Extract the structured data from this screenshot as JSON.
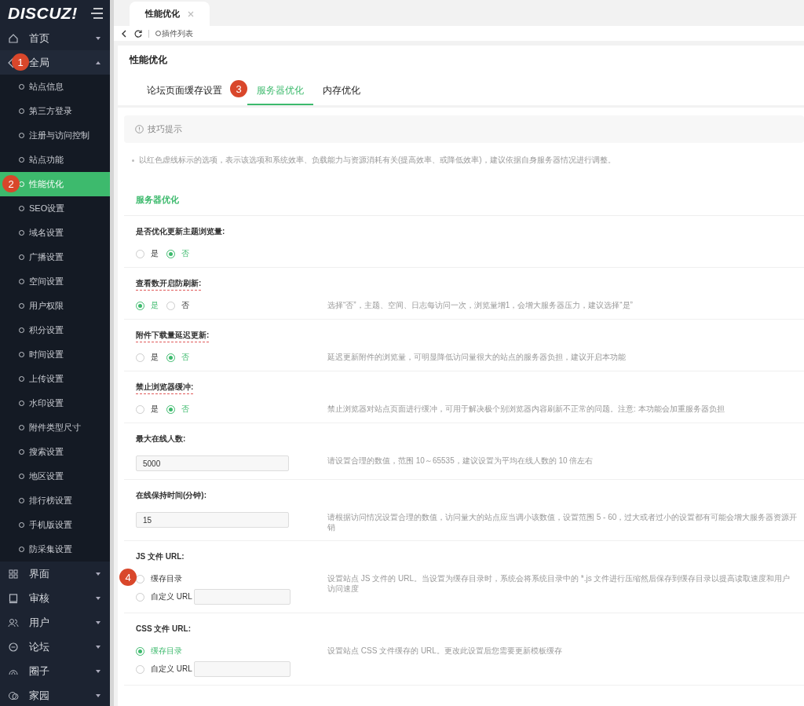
{
  "sidebar": {
    "logo": "DISCUZ!",
    "items": [
      {
        "label": "首页",
        "expanded": false
      },
      {
        "label": "全局",
        "expanded": true,
        "annotation": "1",
        "children": [
          {
            "label": "站点信息",
            "selected": false
          },
          {
            "label": "第三方登录",
            "selected": false
          },
          {
            "label": "注册与访问控制",
            "selected": false
          },
          {
            "label": "站点功能",
            "selected": false
          },
          {
            "label": "性能优化",
            "selected": true,
            "annotation": "2"
          },
          {
            "label": "SEO设置",
            "selected": false
          },
          {
            "label": "域名设置",
            "selected": false
          },
          {
            "label": "广播设置",
            "selected": false
          },
          {
            "label": "空间设置",
            "selected": false
          },
          {
            "label": "用户权限",
            "selected": false
          },
          {
            "label": "积分设置",
            "selected": false
          },
          {
            "label": "时间设置",
            "selected": false
          },
          {
            "label": "上传设置",
            "selected": false
          },
          {
            "label": "水印设置",
            "selected": false
          },
          {
            "label": "附件类型尺寸",
            "selected": false
          },
          {
            "label": "搜索设置",
            "selected": false
          },
          {
            "label": "地区设置",
            "selected": false
          },
          {
            "label": "排行榜设置",
            "selected": false
          },
          {
            "label": "手机版设置",
            "selected": false
          },
          {
            "label": "防采集设置",
            "selected": false
          }
        ]
      },
      {
        "label": "界面",
        "expanded": false
      },
      {
        "label": "审核",
        "expanded": false
      },
      {
        "label": "用户",
        "expanded": false
      },
      {
        "label": "论坛",
        "expanded": false
      },
      {
        "label": "圈子",
        "expanded": false
      },
      {
        "label": "家园",
        "expanded": false
      }
    ]
  },
  "page_tabs": [
    {
      "label": "性能优化",
      "selected": true
    }
  ],
  "toolbar": {
    "link": "插件列表"
  },
  "page": {
    "title": "性能优化",
    "tabs": [
      {
        "label": "论坛页面缓存设置",
        "selected": false
      },
      {
        "label": "服务器优化",
        "selected": true,
        "annotation": "3"
      },
      {
        "label": "内存优化",
        "selected": false
      }
    ]
  },
  "tip": {
    "title": "技巧提示",
    "notes": [
      "以红色虚线标示的选项，表示该选项和系统效率、负载能力与资源消耗有关(提高效率、或降低效率)，建议依据自身服务器情况进行调整。"
    ]
  },
  "section": {
    "title": "服务器优化",
    "rows": [
      {
        "kind": "radio",
        "label": "是否优化更新主题浏览量:",
        "marked": false,
        "options": [
          {
            "label": "是",
            "selected": false
          },
          {
            "label": "否",
            "selected": true
          }
        ]
      },
      {
        "kind": "radio",
        "label": "查看数开启防刷新:",
        "marked": true,
        "options": [
          {
            "label": "是",
            "selected": true
          },
          {
            "label": "否",
            "selected": false
          }
        ],
        "description": "选择“否”，主题、空间、日志每访问一次，浏览量增1，会增大服务器压力，建议选择“是”"
      },
      {
        "kind": "radio",
        "label": "附件下载量延迟更新:",
        "marked": true,
        "options": [
          {
            "label": "是",
            "selected": false
          },
          {
            "label": "否",
            "selected": true
          }
        ],
        "description": "延迟更新附件的浏览量，可明显降低访问量很大的站点的服务器负担，建议开启本功能"
      },
      {
        "kind": "radio",
        "label": "禁止浏览器缓冲:",
        "marked": true,
        "options": [
          {
            "label": "是",
            "selected": false
          },
          {
            "label": "否",
            "selected": true
          }
        ],
        "description": "禁止浏览器对站点页面进行缓冲，可用于解决极个别浏览器内容刷新不正常的问题。注意: 本功能会加重服务器负担"
      },
      {
        "kind": "text",
        "label": "最大在线人数:",
        "marked": false,
        "value": "5000",
        "description": "请设置合理的数值，范围 10～65535，建议设置为平均在线人数的 10 倍左右"
      },
      {
        "kind": "text",
        "label": "在线保持时间(分钟):",
        "marked": false,
        "value": "15",
        "description": "请根据访问情况设置合理的数值，访问量大的站点应当调小该数值，设置范围 5 - 60，过大或者过小的设置都有可能会增大服务器资源开销"
      },
      {
        "kind": "url",
        "label": "JS 文件 URL:",
        "marked": false,
        "options": [
          {
            "label": "缓存目录",
            "selected": false,
            "annotation": "4"
          },
          {
            "label": "自定义 URL",
            "selected": false,
            "field": true
          }
        ],
        "description": "设置站点 JS 文件的 URL。当设置为缓存目录时，系统会将系统目录中的 *.js 文件进行压缩然后保存到缓存目录以提高读取速度和用户访问速度"
      },
      {
        "kind": "url",
        "label": "CSS 文件 URL:",
        "marked": false,
        "options": [
          {
            "label": "缓存目录",
            "selected": true
          },
          {
            "label": "自定义 URL",
            "selected": false,
            "field": true
          }
        ],
        "description": "设置站点 CSS 文件缓存的 URL。更改此设置后您需要更新模板缓存"
      }
    ]
  }
}
